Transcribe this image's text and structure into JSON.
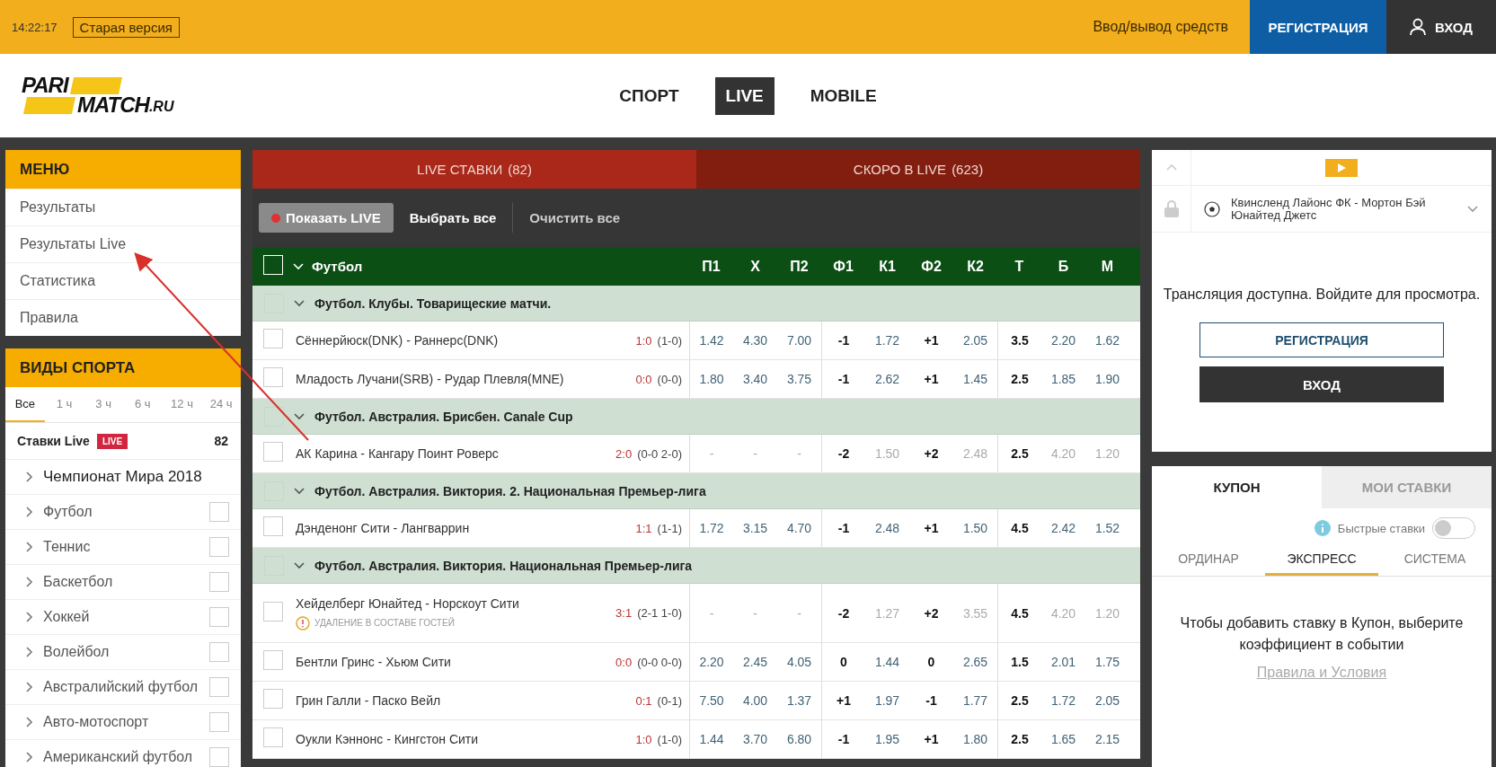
{
  "top_bar": {
    "time": "14:22:17",
    "old_version": "Старая версия",
    "deposit_link": "Ввод/вывод средств",
    "register": "РЕГИСТРАЦИЯ",
    "login": "ВХОД"
  },
  "logo": {
    "line1": "PARI",
    "line2": "MATCH",
    "suffix": ".RU"
  },
  "nav": [
    {
      "label": "СПОРТ",
      "selected": false
    },
    {
      "label": "LIVE",
      "selected": true
    },
    {
      "label": "MOBILE",
      "selected": false
    }
  ],
  "menu": {
    "title": "МЕНЮ",
    "items": [
      "Результаты",
      "Результаты Live",
      "Статистика",
      "Правила"
    ]
  },
  "sports": {
    "title": "ВИДЫ СПОРТА",
    "time_tabs": [
      {
        "label": "Все",
        "selected": true
      },
      {
        "label": "1 ч",
        "selected": false
      },
      {
        "label": "3 ч",
        "selected": false
      },
      {
        "label": "6 ч",
        "selected": false
      },
      {
        "label": "12 ч",
        "selected": false
      },
      {
        "label": "24 ч",
        "selected": false
      }
    ],
    "live_row": {
      "label": "Ставки Live",
      "badge": "LIVE",
      "count": "82"
    },
    "items": [
      {
        "kind": "tournament",
        "label": "Чемпионат Мира 2018"
      },
      {
        "kind": "sport",
        "label": "Футбол",
        "checked": false
      },
      {
        "kind": "sport",
        "label": "Теннис",
        "checked": false
      },
      {
        "kind": "sport",
        "label": "Баскетбол",
        "checked": false
      },
      {
        "kind": "sport",
        "label": "Хоккей",
        "checked": false
      },
      {
        "kind": "sport",
        "label": "Волейбол",
        "checked": false
      },
      {
        "kind": "sport",
        "label": "Австралийский футбол",
        "checked": false
      },
      {
        "kind": "sport",
        "label": "Авто-мотоспорт",
        "checked": false
      },
      {
        "kind": "sport",
        "label": "Американский футбол",
        "checked": false
      }
    ]
  },
  "bet_tabs": [
    {
      "label": "LIVE СТАВКИ",
      "count": "(82)",
      "selected": true
    },
    {
      "label": "СКОРО В LIVE",
      "count": "(623)",
      "selected": false
    }
  ],
  "toolbar": {
    "show_live": "Показать LIVE",
    "select_all": "Выбрать все",
    "clear_all": "Очистить все"
  },
  "table": {
    "sport": "Футбол",
    "checked": false,
    "columns": [
      {
        "label": "П1",
        "kind": "odds"
      },
      {
        "label": "Х",
        "kind": "odds"
      },
      {
        "label": "П2",
        "kind": "odds"
      },
      {
        "label": "Ф1",
        "kind": "line"
      },
      {
        "label": "К1",
        "kind": "odds"
      },
      {
        "label": "Ф2",
        "kind": "line"
      },
      {
        "label": "К2",
        "kind": "odds"
      },
      {
        "label": "Т",
        "kind": "line"
      },
      {
        "label": "Б",
        "kind": "odds"
      },
      {
        "label": "М",
        "kind": "odds"
      }
    ],
    "rows": [
      {
        "kind": "group",
        "title": "Футбол. Клубы. Товарищеские матчи."
      },
      {
        "kind": "match",
        "checked": false,
        "name": "Сённерйюск(DNK) - Раннерс(DNK)",
        "score": "1:0",
        "detail": "(1-0)",
        "inactive": false,
        "cells": [
          "1.42",
          "4.30",
          "7.00",
          "-1",
          "1.72",
          "+1",
          "2.05",
          "3.5",
          "2.20",
          "1.62"
        ]
      },
      {
        "kind": "match",
        "checked": false,
        "name": "Младость Лучани(SRB) - Рудар Плевля(MNE)",
        "score": "0:0",
        "detail": "(0-0)",
        "inactive": false,
        "cells": [
          "1.80",
          "3.40",
          "3.75",
          "-1",
          "2.62",
          "+1",
          "1.45",
          "2.5",
          "1.85",
          "1.90"
        ]
      },
      {
        "kind": "group",
        "title": "Футбол. Австралия. Брисбен. Canale Cup"
      },
      {
        "kind": "match",
        "checked": false,
        "name": "АК Карина - Кангару Поинт Роверс",
        "score": "2:0",
        "detail": "(0-0 2-0)",
        "inactive": true,
        "cells": [
          "-",
          "-",
          "-",
          "-2",
          "1.50",
          "+2",
          "2.48",
          "2.5",
          "4.20",
          "1.20"
        ]
      },
      {
        "kind": "group",
        "title": "Футбол. Австралия. Виктория. 2. Национальная Премьер-лига"
      },
      {
        "kind": "match",
        "checked": false,
        "name": "Дэнденонг Сити - Лангваррин",
        "score": "1:1",
        "detail": "(1-1)",
        "inactive": false,
        "cells": [
          "1.72",
          "3.15",
          "4.70",
          "-1",
          "2.48",
          "+1",
          "1.50",
          "4.5",
          "2.42",
          "1.52"
        ]
      },
      {
        "kind": "group",
        "title": "Футбол. Австралия. Виктория. Национальная Премьер-лига"
      },
      {
        "kind": "match",
        "checked": false,
        "name": "Хейделберг Юнайтед - Норскоут Сити",
        "notice": "УДАЛЕНИЕ В СОСТАВЕ ГОСТЕЙ",
        "score": "3:1",
        "detail": "(2-1 1-0)",
        "inactive": true,
        "cells": [
          "-",
          "-",
          "-",
          "-2",
          "1.27",
          "+2",
          "3.55",
          "4.5",
          "4.20",
          "1.20"
        ]
      },
      {
        "kind": "match",
        "checked": false,
        "name": "Бентли Гринс - Хьюм Сити",
        "score": "0:0",
        "detail": "(0-0 0-0)",
        "inactive": false,
        "cells": [
          "2.20",
          "2.45",
          "4.05",
          "0",
          "1.44",
          "0",
          "2.65",
          "1.5",
          "2.01",
          "1.75"
        ]
      },
      {
        "kind": "match",
        "checked": false,
        "name": "Грин Галли - Паско Вейл",
        "score": "0:1",
        "detail": "(0-1)",
        "inactive": false,
        "cells": [
          "7.50",
          "4.00",
          "1.37",
          "+1",
          "1.97",
          "-1",
          "1.77",
          "2.5",
          "1.72",
          "2.05"
        ]
      },
      {
        "kind": "match",
        "checked": false,
        "name": "Оукли Кэннонс - Кингстон Сити",
        "score": "1:0",
        "detail": "(1-0)",
        "inactive": false,
        "cells": [
          "1.44",
          "3.70",
          "6.80",
          "-1",
          "1.95",
          "+1",
          "1.80",
          "2.5",
          "1.65",
          "2.15"
        ]
      }
    ]
  },
  "stream": {
    "match": "Квинсленд Лайонс ФК - Мортон Бэй Юнайтед Джетс",
    "message": "Трансляция доступна. Войдите для просмотра.",
    "register": "РЕГИСТРАЦИЯ",
    "login": "ВХОД"
  },
  "coupon": {
    "tabs": [
      {
        "label": "КУПОН",
        "selected": true
      },
      {
        "label": "МОИ СТАВКИ",
        "selected": false
      }
    ],
    "quick_bets": {
      "label": "Быстрые ставки",
      "on": false
    },
    "types": [
      {
        "label": "ОРДИНАР",
        "selected": false
      },
      {
        "label": "ЭКСПРЕСС",
        "selected": true
      },
      {
        "label": "СИСТЕМА",
        "selected": false
      }
    ],
    "hint": "Чтобы добавить ставку в Купон, выберите коэффициент в событии",
    "rules_link": "Правила и Условия"
  }
}
